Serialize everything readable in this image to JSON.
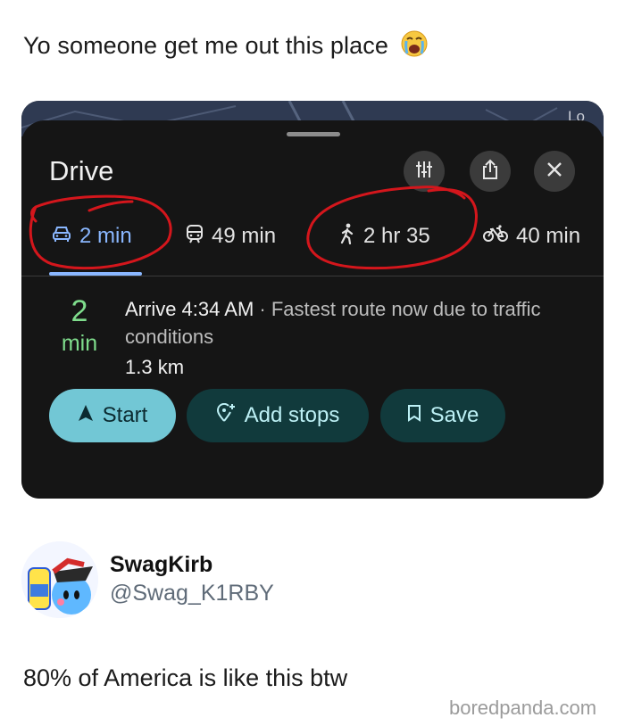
{
  "post": {
    "caption": "Yo someone get me out this place",
    "emoji_icon": "loudly-crying-face-emoji"
  },
  "maps": {
    "title": "Drive",
    "tabs": [
      {
        "mode": "car",
        "icon": "car-icon",
        "label": "2 min",
        "active": true
      },
      {
        "mode": "transit",
        "icon": "train-icon",
        "label": "49 min",
        "active": false
      },
      {
        "mode": "walk",
        "icon": "walking-icon",
        "label": "2 hr 35",
        "active": false
      },
      {
        "mode": "bike",
        "icon": "bicycle-icon",
        "label": "40 min",
        "active": false
      }
    ],
    "eta_big_number": "2",
    "eta_big_unit": "min",
    "arrive_label": "Arrive 4:34 AM",
    "separator": " · ",
    "route_note": "Fastest route now due to traffic conditions",
    "distance": "1.3 km",
    "buttons": {
      "start": "Start",
      "add_stops": "Add stops",
      "save": "Save"
    },
    "map_label_fragment": "Lo",
    "colors": {
      "accent_blue": "#8ab7ff",
      "eta_green": "#7fdc8c",
      "start_button": "#72c7d5",
      "annotation_red": "#d4161c"
    }
  },
  "reply": {
    "display_name": "SwagKirb",
    "username": "@Swag_K1RBY",
    "text": "80% of America is like this btw"
  },
  "watermark": "boredpanda.com"
}
